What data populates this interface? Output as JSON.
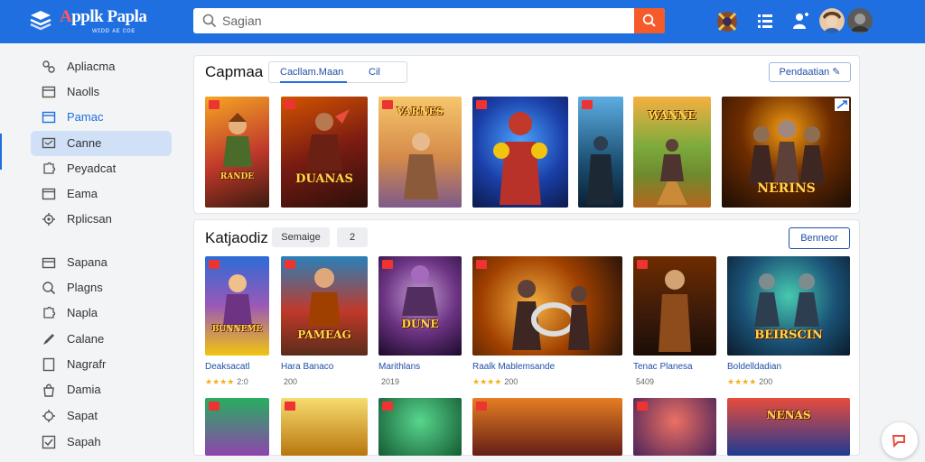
{
  "header": {
    "brand_left": "A",
    "brand_right": "pplk Paplа",
    "brand_sub": "ᴡɪᴅᴅ ᴀᴇ ᴄᴏᴇ",
    "search_placeholder": "Sagian"
  },
  "sidebar": {
    "items": [
      {
        "label": "Apliacma",
        "icon": "gamepad-icon"
      },
      {
        "label": "Naolls",
        "icon": "grid-icon"
      },
      {
        "label": "Pamac",
        "icon": "monitor-icon"
      },
      {
        "label": "Canne",
        "icon": "chat-icon"
      },
      {
        "label": "Peyadcat",
        "icon": "puzzle-icon"
      },
      {
        "label": "Eama",
        "icon": "window-icon"
      },
      {
        "label": "Rplicsan",
        "icon": "gear-icon"
      },
      {
        "label": "Sapana",
        "icon": "tray-icon"
      },
      {
        "label": "Plagns",
        "icon": "search-icon"
      },
      {
        "label": "Napla",
        "icon": "puzzle-icon"
      },
      {
        "label": "Calane",
        "icon": "pen-icon"
      },
      {
        "label": "Nagrafr",
        "icon": "file-icon"
      },
      {
        "label": "Damia",
        "icon": "bag-icon"
      },
      {
        "label": "Sapat",
        "icon": "gear-icon"
      },
      {
        "label": "Sapah",
        "icon": "check-box-icon"
      }
    ]
  },
  "featured": {
    "title": "Capmaa",
    "tab_active": "Cacllam.Maan",
    "tab_other": "Cil",
    "action": "Pendaatian",
    "cards": [
      {
        "caption": "RANDE"
      },
      {
        "caption": "DUANAS"
      },
      {
        "caption": "VARNES"
      },
      {
        "caption": ""
      },
      {
        "caption": ""
      },
      {
        "caption": "WANNE"
      },
      {
        "caption": "NERINS"
      }
    ]
  },
  "catalog": {
    "title": "Katjaodiz",
    "chip1": "Semaige",
    "chip2": "2",
    "action": "Benneor",
    "cards": [
      {
        "caption": "BUNNEME",
        "title": "Deaksacatl",
        "stars": "★★★★",
        "count": "2:0"
      },
      {
        "caption": "PAMEAG",
        "title": "Hara Banaco",
        "stars": "★★★★",
        "count": "200"
      },
      {
        "caption": "DUNE",
        "title": "Marithlans",
        "stars": "",
        "count": "2019"
      },
      {
        "caption": "",
        "title": "Raalk Mablemsande",
        "stars": "★★★★",
        "count": "200"
      },
      {
        "caption": "",
        "title": "Tenac Planesa",
        "stars": "",
        "count": "5409"
      },
      {
        "caption": "BEIRSCIN",
        "title": "Boldelldadian",
        "stars": "★★★★",
        "count": "200"
      }
    ],
    "row2_captions": [
      "",
      "",
      "",
      "",
      "",
      "NENAS"
    ]
  }
}
